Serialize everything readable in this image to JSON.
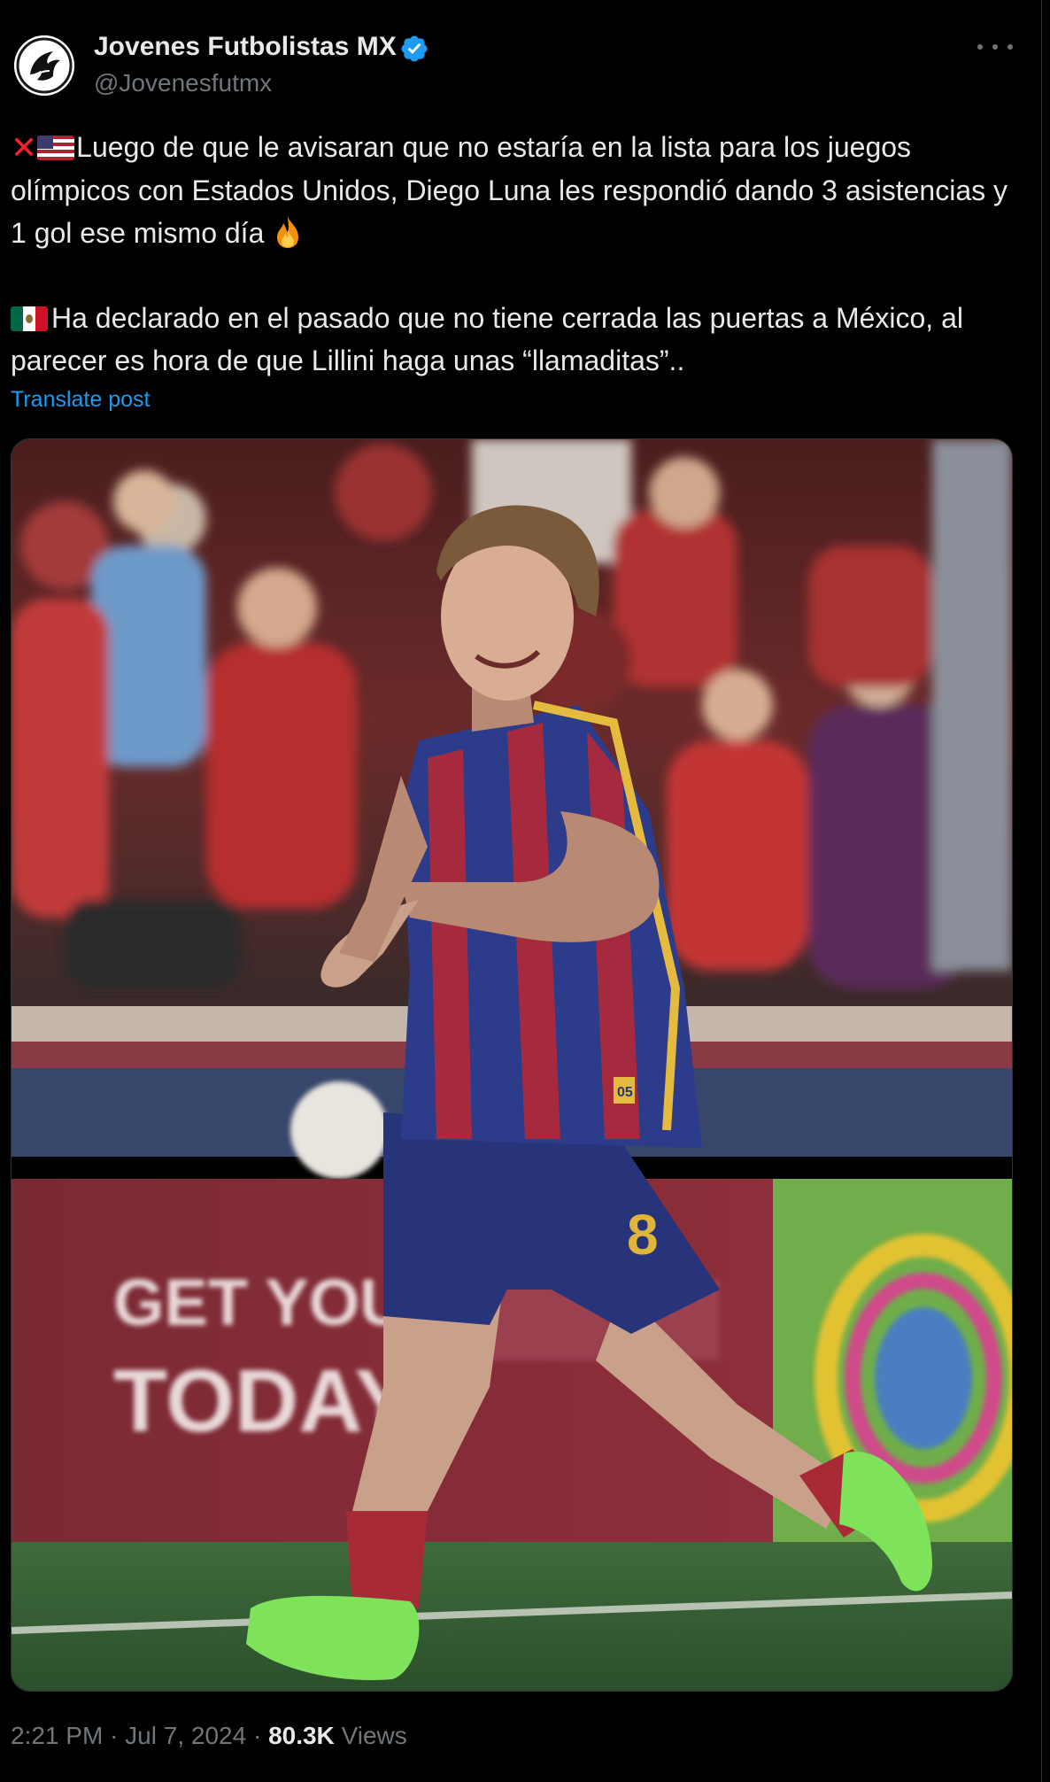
{
  "account": {
    "display_name": "Jovenes Futbolistas MX",
    "handle": "@Jovenesfutmx",
    "verified": true
  },
  "post": {
    "paragraph1": "Luego de que le avisaran que no estaría en la lista para los juegos olímpicos con Estados Unidos, Diego Luna les respondió dando 3 asistencias y 1 gol ese mismo día",
    "paragraph2": "Ha declarado en el pasado que no tiene cerrada las puertas a México, al parecer es hora de que Lillini haga unas “llamaditas”..",
    "translate_label": "Translate post",
    "emojis": [
      "cross-mark",
      "us-flag",
      "fire",
      "mexico-flag"
    ]
  },
  "photo": {
    "ad_text": [
      "GET YOURS",
      "TODAY!!"
    ],
    "jersey_number": "8",
    "badge": "05"
  },
  "meta": {
    "time": "2:21 PM",
    "date": "Jul 7, 2024",
    "views_count": "80.3K",
    "views_label": "Views",
    "separator": "·"
  },
  "colors": {
    "background": "#000000",
    "text": "#e7e9ea",
    "secondary": "#71767b",
    "link": "#1d9bf0",
    "verified": "#1d9bf0"
  }
}
